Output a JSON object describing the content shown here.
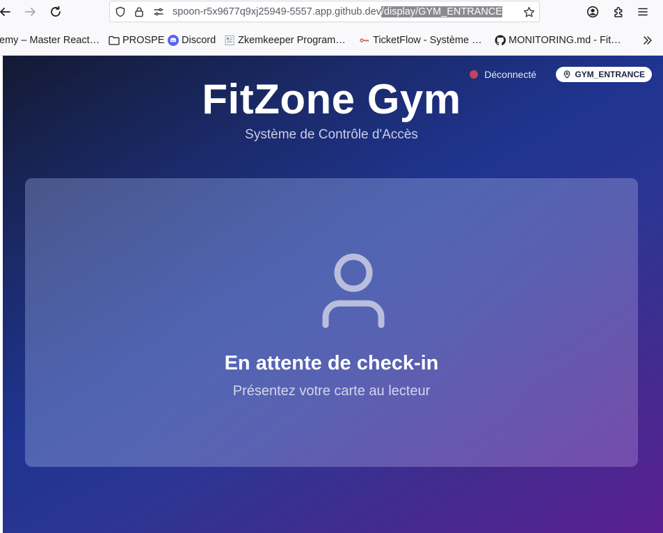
{
  "browser": {
    "url_prefix": "spoon-r5x9677q9xj25949-5557.app.github.dev",
    "url_selected": "/display/GYM_ENTRANCE",
    "icons": [
      "back-icon",
      "forward-icon",
      "reload-icon",
      "shield-icon",
      "lock-icon",
      "permissions-icon",
      "star-icon",
      "account-icon",
      "extensions-icon",
      "menu-icon"
    ]
  },
  "bookmarks": [
    {
      "label": "emy – Master React…",
      "icon": "none"
    },
    {
      "label": "PROSPE",
      "icon": "folder-icon"
    },
    {
      "label": "Discord",
      "icon": "discord-icon"
    },
    {
      "label": "Zkemkeeper Program…",
      "icon": "document-icon"
    },
    {
      "label": "TicketFlow - Système …",
      "icon": "ticketflow-icon"
    },
    {
      "label": "MONITORING.md - Fit…",
      "icon": "github-icon"
    }
  ],
  "header": {
    "status_text": "Déconnecté",
    "status_color": "#c0445a",
    "location": "GYM_ENTRANCE",
    "title": "FitZone Gym",
    "subtitle": "Système de Contrôle d'Accès"
  },
  "card": {
    "title": "En attente de check-in",
    "subtitle": "Présentez votre carte au lecteur",
    "icon": "user-icon"
  }
}
